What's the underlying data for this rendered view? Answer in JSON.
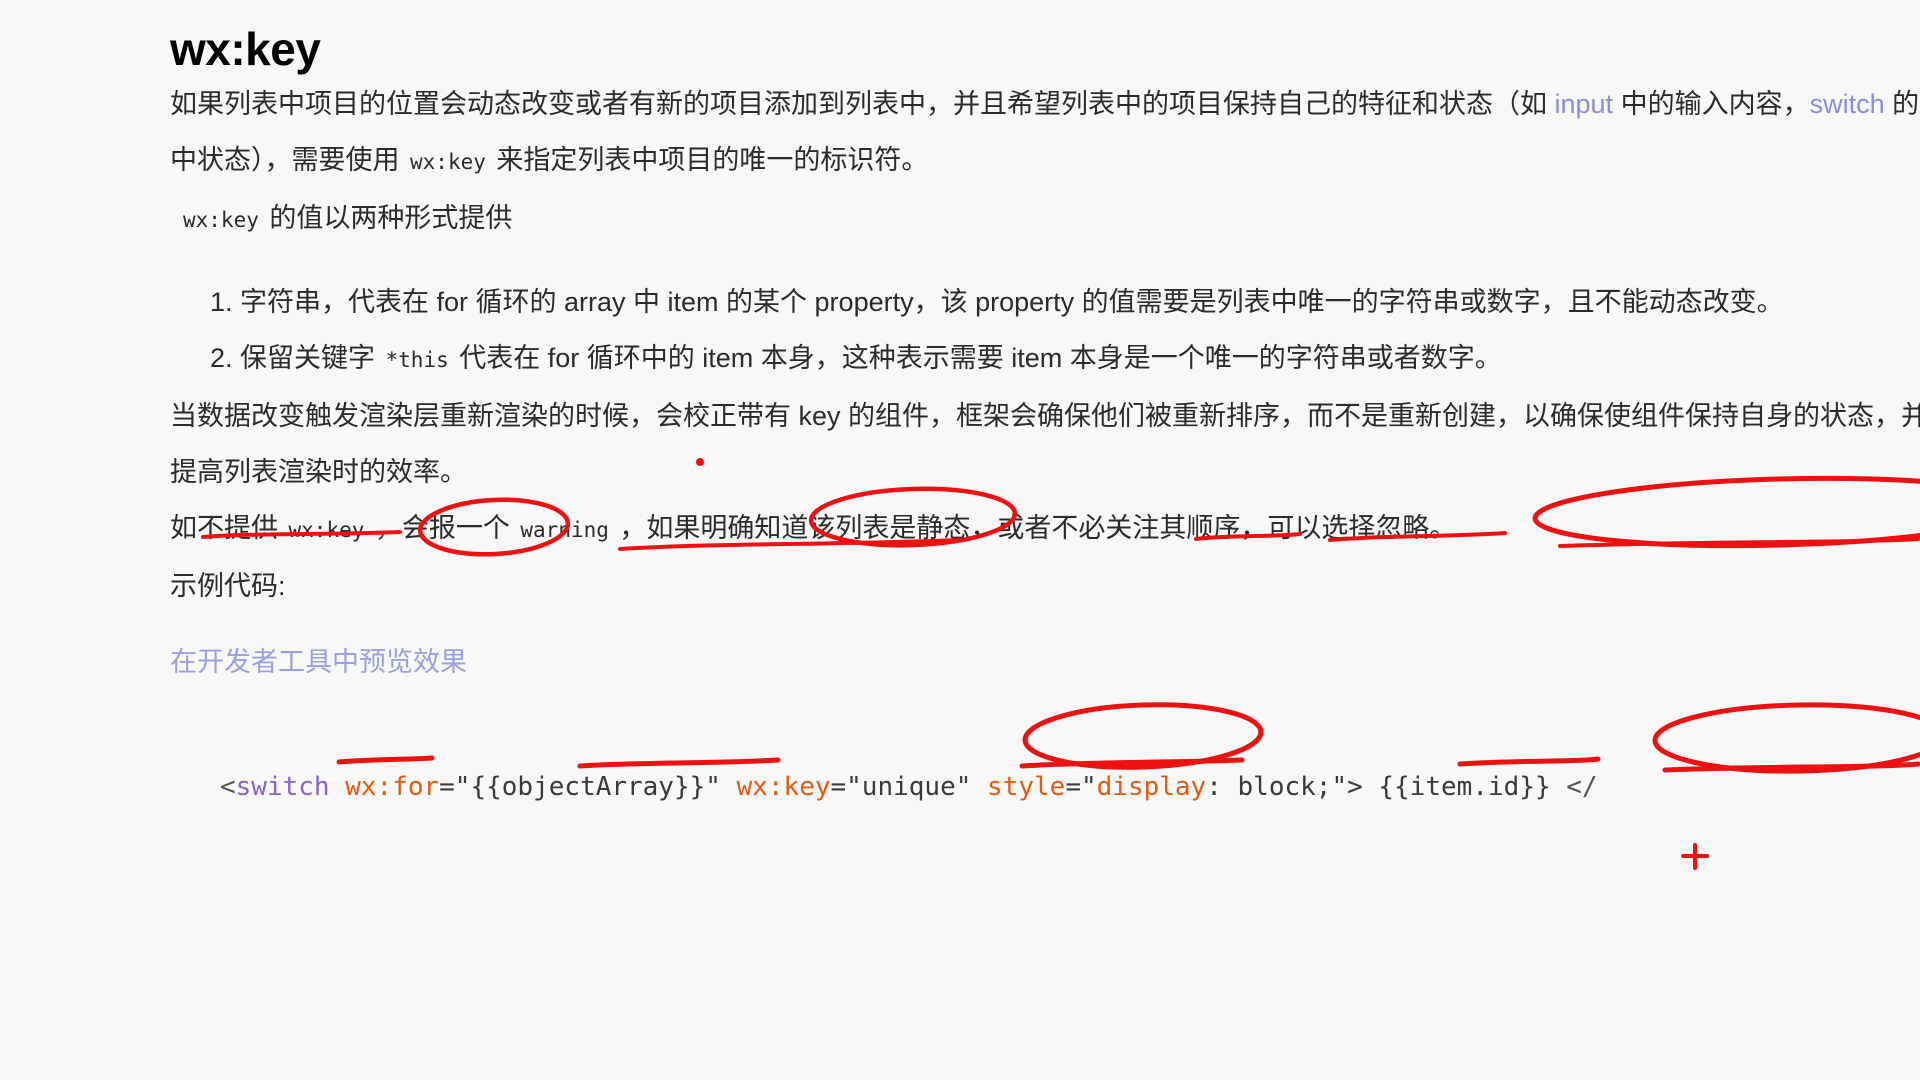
{
  "page": {
    "background": "#f8f8f9",
    "title": "wx:key"
  },
  "intro": {
    "seg1": "如果列表中项目的位置会动态改变或者有新的项目添加到列表中，并且希望列表中的项目保持自己的特征和状态（如 ",
    "link_input": "input",
    "seg2": " 中的输入内容，",
    "link_switch": "switch",
    "seg3": " 的选中状态），需要使用 ",
    "code_wxkey": "wx:key",
    "seg4": " 来指定列表中项目的唯一的标识符。"
  },
  "value_forms": {
    "code": "wx:key",
    "text": " 的值以两种形式提供"
  },
  "list": {
    "items": [
      {
        "seg1": "字符串，代表在 for 循环的 array 中 item 的某个 property，该 property 的值需要是列表中唯一的字符串或数字，且不能动态改变。"
      },
      {
        "seg1": "保留关键字 ",
        "code": "*this",
        "seg2": " 代表在 for 循环中的 item 本身，这种表示需要 item 本身是一个唯一的字符串或者数字。"
      }
    ]
  },
  "explain": {
    "text": "当数据改变触发渲染层重新渲染的时候，会校正带有 key 的组件，框架会确保他们被重新排序，而不是重新创建，以确保使组件保持自身的状态，并且提高列表渲染时的效率。"
  },
  "warning": {
    "seg1": "如不提供 ",
    "code1": "wx:key",
    "seg2": " ，会报一个 ",
    "code2": "warning",
    "seg3": " ，如果明确知道该列表是静态，或者不必关注其顺序，可以选择忽略。"
  },
  "sample": {
    "heading": "示例代码:",
    "preview_link": "在开发者工具中预览效果"
  },
  "code_block": {
    "tokens": [
      {
        "t": "<",
        "c": "punct"
      },
      {
        "t": "switch",
        "c": "tag"
      },
      {
        "t": " ",
        "c": "punct"
      },
      {
        "t": "wx:for",
        "c": "attr"
      },
      {
        "t": "=\"{{objectArray}}\" ",
        "c": "str"
      },
      {
        "t": "wx:key",
        "c": "attr"
      },
      {
        "t": "=\"unique\" ",
        "c": "str"
      },
      {
        "t": "style",
        "c": "attr"
      },
      {
        "t": "=\"",
        "c": "str"
      },
      {
        "t": "display",
        "c": "prop"
      },
      {
        "t": ": block;\"> {{item.id}} ",
        "c": "str"
      },
      {
        "t": "</",
        "c": "punct"
      }
    ],
    "plain": "<switch wx:for=\"{{objectArray}}\" wx:key=\"unique\" style=\"display: block;\"> {{item.id}} </"
  },
  "annotations": {
    "color": "#ee1111",
    "marks": [
      {
        "name": "dot-mark-above-item2",
        "type": "dot"
      },
      {
        "name": "underline-item2-start",
        "type": "underline"
      },
      {
        "name": "ellipse-this-keyword",
        "type": "ellipse"
      },
      {
        "name": "ellipse-de-item",
        "type": "ellipse"
      },
      {
        "name": "underline-item2-tail",
        "type": "underline"
      },
      {
        "name": "underline-item-benshen",
        "type": "underline"
      },
      {
        "name": "underline-ben-shen-shi",
        "type": "underline"
      },
      {
        "name": "ellipse-unique-string-number",
        "type": "ellipse"
      },
      {
        "name": "underline-wxkey-warning",
        "type": "underline"
      },
      {
        "name": "underline-warning-word",
        "type": "underline"
      },
      {
        "name": "ellipse-static-list",
        "type": "ellipse"
      },
      {
        "name": "underline-order",
        "type": "underline"
      },
      {
        "name": "ellipse-can-ignore",
        "type": "ellipse"
      },
      {
        "name": "plus-mark",
        "type": "plus"
      }
    ]
  }
}
